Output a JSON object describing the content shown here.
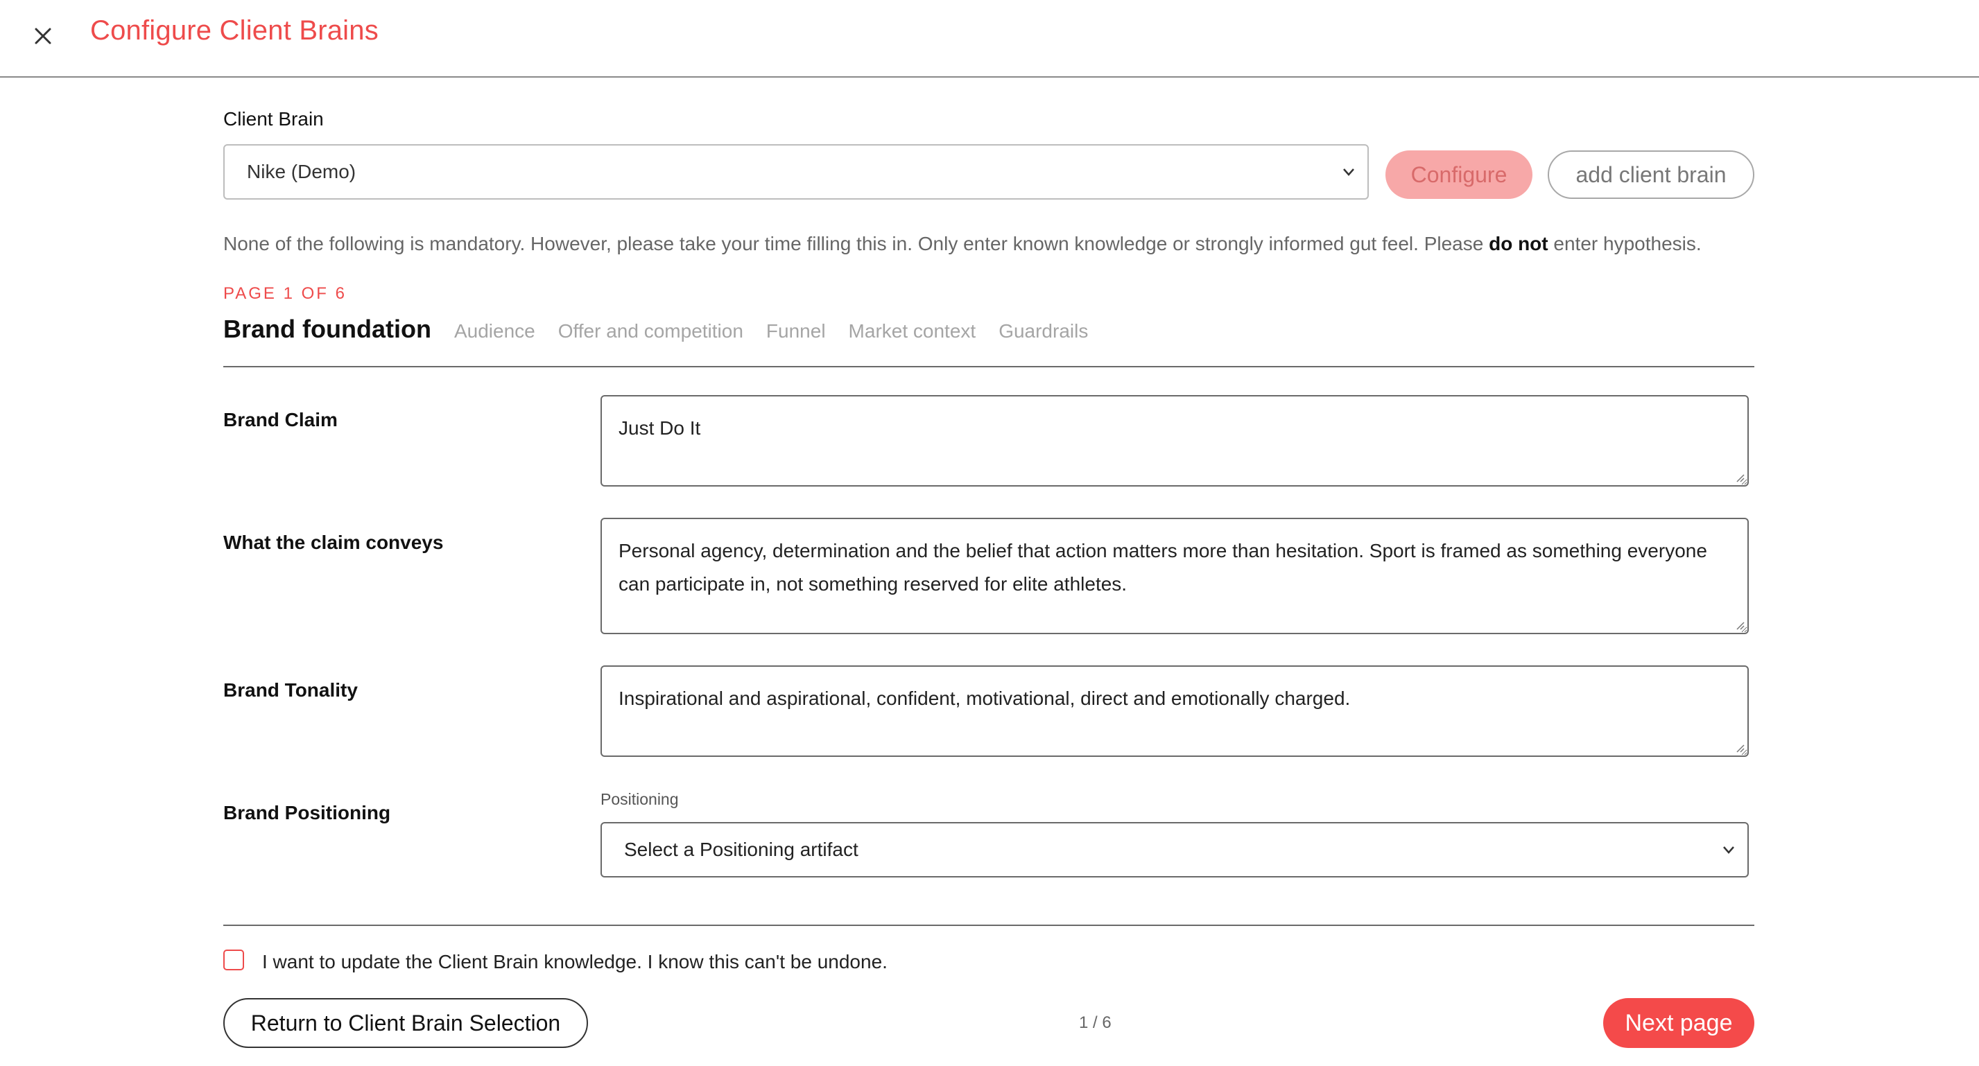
{
  "header": {
    "title": "Configure Client Brains",
    "close_icon": "close-icon"
  },
  "client_brain": {
    "label": "Client Brain",
    "selected": "Nike (Demo)",
    "configure_label": "Configure",
    "add_label": "add client brain"
  },
  "info": {
    "text_before": "None of the following is mandatory. However, please take your time filling this in. Only enter known knowledge or strongly informed gut feel. Please ",
    "emphasis": "do not",
    "text_after": " enter hypothesis."
  },
  "page_indicator": "PAGE 1 OF 6",
  "tabs": [
    {
      "label": "Brand foundation",
      "active": true
    },
    {
      "label": "Audience",
      "active": false
    },
    {
      "label": "Offer and competition",
      "active": false
    },
    {
      "label": "Funnel",
      "active": false
    },
    {
      "label": "Market context",
      "active": false
    },
    {
      "label": "Guardrails",
      "active": false
    }
  ],
  "fields": {
    "brand_claim": {
      "label": "Brand Claim",
      "value": "Just Do It"
    },
    "claim_conveys": {
      "label": "What the claim conveys",
      "value": "Personal agency, determination and the belief that action matters more than hesitation. Sport is framed as something everyone can participate in, not something reserved for elite athletes."
    },
    "brand_tonality": {
      "label": "Brand Tonality",
      "value": "Inspirational and aspirational, confident, motivational, direct and emotionally charged."
    },
    "brand_positioning": {
      "label": "Brand Positioning",
      "sub_label": "Positioning",
      "placeholder": "Select a Positioning artifact"
    }
  },
  "footer": {
    "checkbox_label": "I want to update the Client Brain knowledge. I know this can't be undone.",
    "checkbox_checked": false,
    "return_label": "Return to Client Brain Selection",
    "pager": "1 / 6",
    "next_label": "Next page"
  },
  "colors": {
    "accent": "#ee4b4b",
    "configure_bg": "#f7a8a8",
    "next_bg": "#f44a4a"
  }
}
